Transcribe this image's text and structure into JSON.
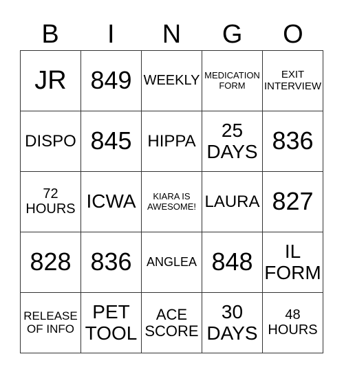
{
  "header": [
    "B",
    "I",
    "N",
    "G",
    "O"
  ],
  "cells": [
    [
      {
        "t": "JR",
        "s": 38
      },
      {
        "t": "849",
        "s": 36
      },
      {
        "t": "WEEKLY",
        "s": 20
      },
      {
        "t": "MEDICATION\nFORM",
        "s": 13
      },
      {
        "t": "EXIT\nINTERVIEW",
        "s": 15
      }
    ],
    [
      {
        "t": "DISPO",
        "s": 24
      },
      {
        "t": "845",
        "s": 36
      },
      {
        "t": "HIPPA",
        "s": 24
      },
      {
        "t": "25\nDAYS",
        "s": 28
      },
      {
        "t": "836",
        "s": 36
      }
    ],
    [
      {
        "t": "72\nHOURS",
        "s": 20
      },
      {
        "t": "ICWA",
        "s": 28
      },
      {
        "t": "KIARA IS\nAWESOME!",
        "s": 13
      },
      {
        "t": "LAURA",
        "s": 24
      },
      {
        "t": "827",
        "s": 36
      }
    ],
    [
      {
        "t": "828",
        "s": 36
      },
      {
        "t": "836",
        "s": 36
      },
      {
        "t": "ANGLEA",
        "s": 18
      },
      {
        "t": "848",
        "s": 36
      },
      {
        "t": "IL\nFORM",
        "s": 28
      }
    ],
    [
      {
        "t": "RELEASE\nOF INFO",
        "s": 17
      },
      {
        "t": "PET\nTOOL",
        "s": 28
      },
      {
        "t": "ACE\nSCORE",
        "s": 22
      },
      {
        "t": "30\nDAYS",
        "s": 28
      },
      {
        "t": "48\nHOURS",
        "s": 20
      }
    ]
  ]
}
